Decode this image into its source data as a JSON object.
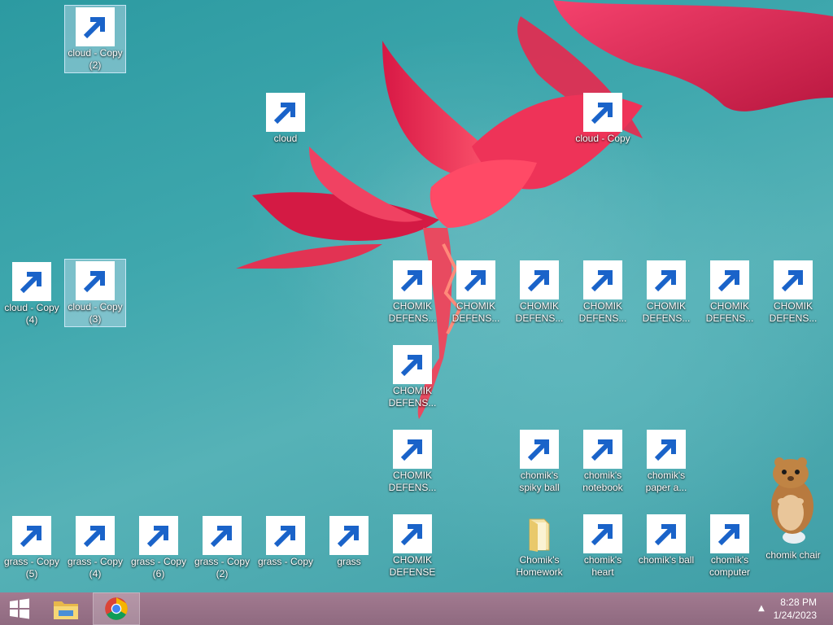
{
  "desktop": {
    "icons": {
      "cloud_copy_2": {
        "label": "cloud - Copy (2)",
        "type": "cloud"
      },
      "cloud": {
        "label": "cloud",
        "type": "cloud"
      },
      "cloud_copy": {
        "label": "cloud - Copy",
        "type": "cloud"
      },
      "cloud_copy_4": {
        "label": "cloud - Copy (4)",
        "type": "cloud"
      },
      "cloud_copy_3": {
        "label": "cloud - Copy (3)",
        "type": "cloud"
      },
      "defender_1": {
        "label": "CHOMIK DEFENS...",
        "type": "shield"
      },
      "defender_2": {
        "label": "CHOMIK DEFENS...",
        "type": "shield"
      },
      "defender_3": {
        "label": "CHOMIK DEFENS...",
        "type": "shield"
      },
      "defender_4": {
        "label": "CHOMIK DEFENS...",
        "type": "shield"
      },
      "defender_5": {
        "label": "CHOMIK DEFENS...",
        "type": "shield"
      },
      "defender_6": {
        "label": "CHOMIK DEFENS...",
        "type": "shield"
      },
      "defender_7": {
        "label": "CHOMIK DEFENS...",
        "type": "shield"
      },
      "defender_8": {
        "label": "CHOMIK DEFENS...",
        "type": "shield"
      },
      "defender_9": {
        "label": "CHOMIK DEFENS...",
        "type": "shield"
      },
      "defender_10": {
        "label": "CHOMIK DEFENSE",
        "type": "shield"
      },
      "spiky_ball": {
        "label": "chomik's spiky ball",
        "type": "spiky-ball"
      },
      "notebook": {
        "label": "chomik's notebook",
        "type": "notebook"
      },
      "paper_airplane": {
        "label": "chomik's paper a...",
        "type": "paper-airplane"
      },
      "grass_copy_5": {
        "label": "grass - Copy (5)",
        "type": "grass"
      },
      "grass_copy_4": {
        "label": "grass - Copy (4)",
        "type": "grass"
      },
      "grass_copy_6": {
        "label": "grass - Copy (6)",
        "type": "grass"
      },
      "grass_copy_2": {
        "label": "grass - Copy (2)",
        "type": "grass"
      },
      "grass_copy": {
        "label": "grass - Copy",
        "type": "grass"
      },
      "grass": {
        "label": "grass",
        "type": "grass"
      },
      "homework": {
        "label": "Chomik's Homework",
        "type": "folder"
      },
      "heart": {
        "label": "chomik's heart",
        "type": "box"
      },
      "ball": {
        "label": "chomik's ball",
        "type": "chrome"
      },
      "computer": {
        "label": "chomik's computer",
        "type": "computer"
      },
      "chair": {
        "label": "chomik chair",
        "type": "hamster"
      }
    }
  },
  "taskbar": {
    "start_icon": "windows-logo-icon",
    "pinned": [
      {
        "name": "file-explorer-icon"
      },
      {
        "name": "chrome-icon",
        "active": true
      }
    ],
    "tray": {
      "time": "8:28 PM",
      "date": "1/24/2023",
      "overflow_icon": "chevron-up-icon"
    }
  },
  "colors": {
    "desktop_bg": "#3ea7ad",
    "taskbar_bg": "#9a7489",
    "flower": "#e8284e",
    "shield_blue": "#0e74d6"
  }
}
